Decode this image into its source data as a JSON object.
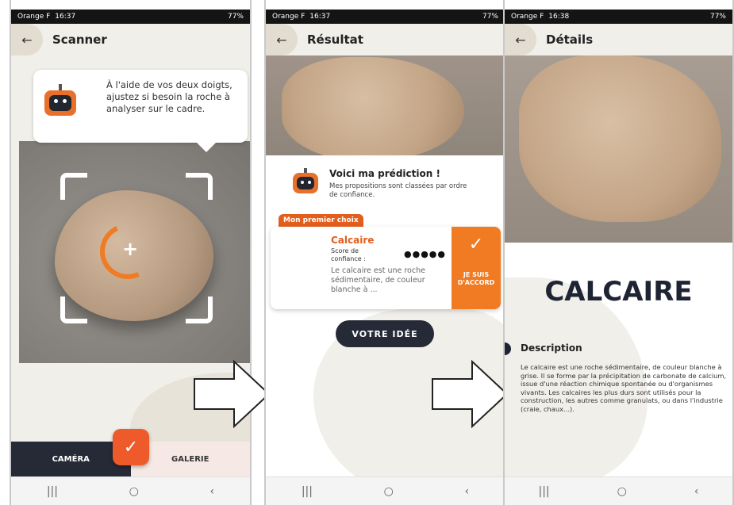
{
  "status": {
    "p1": {
      "carrier": "Orange F",
      "time": "16:37",
      "battery": "77%"
    },
    "p2": {
      "carrier": "Orange F",
      "time": "16:37",
      "battery": "77%"
    },
    "p3": {
      "carrier": "Orange F",
      "time": "16:38",
      "battery": "77%"
    }
  },
  "screen1": {
    "title": "Scanner",
    "bubble": "À l'aide de vos deux doigts, ajustez si besoin la roche à analyser sur le cadre.",
    "tab_camera": "CAMÉRA",
    "tab_gallery": "GALERIE"
  },
  "screen2": {
    "title": "Résultat",
    "pred_title": "Voici ma prédiction !",
    "pred_sub": "Mes propositions sont classées par ordre de confiance.",
    "chip": "Mon premier choix",
    "card_name": "Calcaire",
    "card_score_label": "Score de confiance :",
    "card_score_dots": "●●●●●",
    "card_desc": "Le calcaire est une roche sédimentaire, de couleur blanche à ...",
    "agree": "JE SUIS D'ACCORD",
    "idea_button": "VOTRE IDÉE"
  },
  "screen3": {
    "title": "Détails",
    "big_title": "CALCAIRE",
    "desc_heading": "Description",
    "desc_text": "Le calcaire est une roche sédimentaire, de couleur blanche à grise. Il se forme par la précipitation de carbonate de calcium, issue d'une réaction chimique spontanée ou d'organismes vivants. Les calcaires les plus durs sont utilisés pour la construction, les autres comme granulats, ou dans l'industrie (craie, chaux...)."
  },
  "nav": {
    "recent": "|||",
    "home": "○",
    "back": "‹"
  },
  "icons": {
    "back": "arrow-left-icon",
    "check": "check-icon",
    "robot": "robot-mascot-icon"
  },
  "colors": {
    "accent": "#f07b22",
    "dark": "#252a36",
    "bg": "#f1efea"
  }
}
